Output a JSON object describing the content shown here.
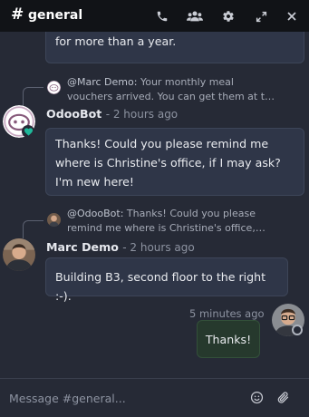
{
  "header": {
    "hash": "#",
    "title": "general"
  },
  "messages": {
    "m1": {
      "text": "for more than a year."
    },
    "m2": {
      "reply_author": "@Marc Demo:",
      "reply_text": "Your monthly meal vouchers arrived. You can get them at t…",
      "author": "OdooBot",
      "time": "- 2 hours ago",
      "text": "Thanks! Could you please remind me where is Christine's office, if I may ask? I'm new here!"
    },
    "m3": {
      "reply_author": "@OdooBot:",
      "reply_text": "Thanks! Could you please remind me where is Christine's office, if…",
      "author": "Marc Demo",
      "time": "- 2 hours ago",
      "text": "Building B3, second floor to the right :-)."
    },
    "m4": {
      "time": "5 minutes ago",
      "text": "Thanks!"
    }
  },
  "composer": {
    "placeholder": "Message #general..."
  },
  "colors": {
    "header_bg": "#111317",
    "thread_bg": "#262a36",
    "bubble_bg": "#2f3648",
    "own_bubble_bg": "#26392d",
    "online_badge": "#1fb89a"
  }
}
